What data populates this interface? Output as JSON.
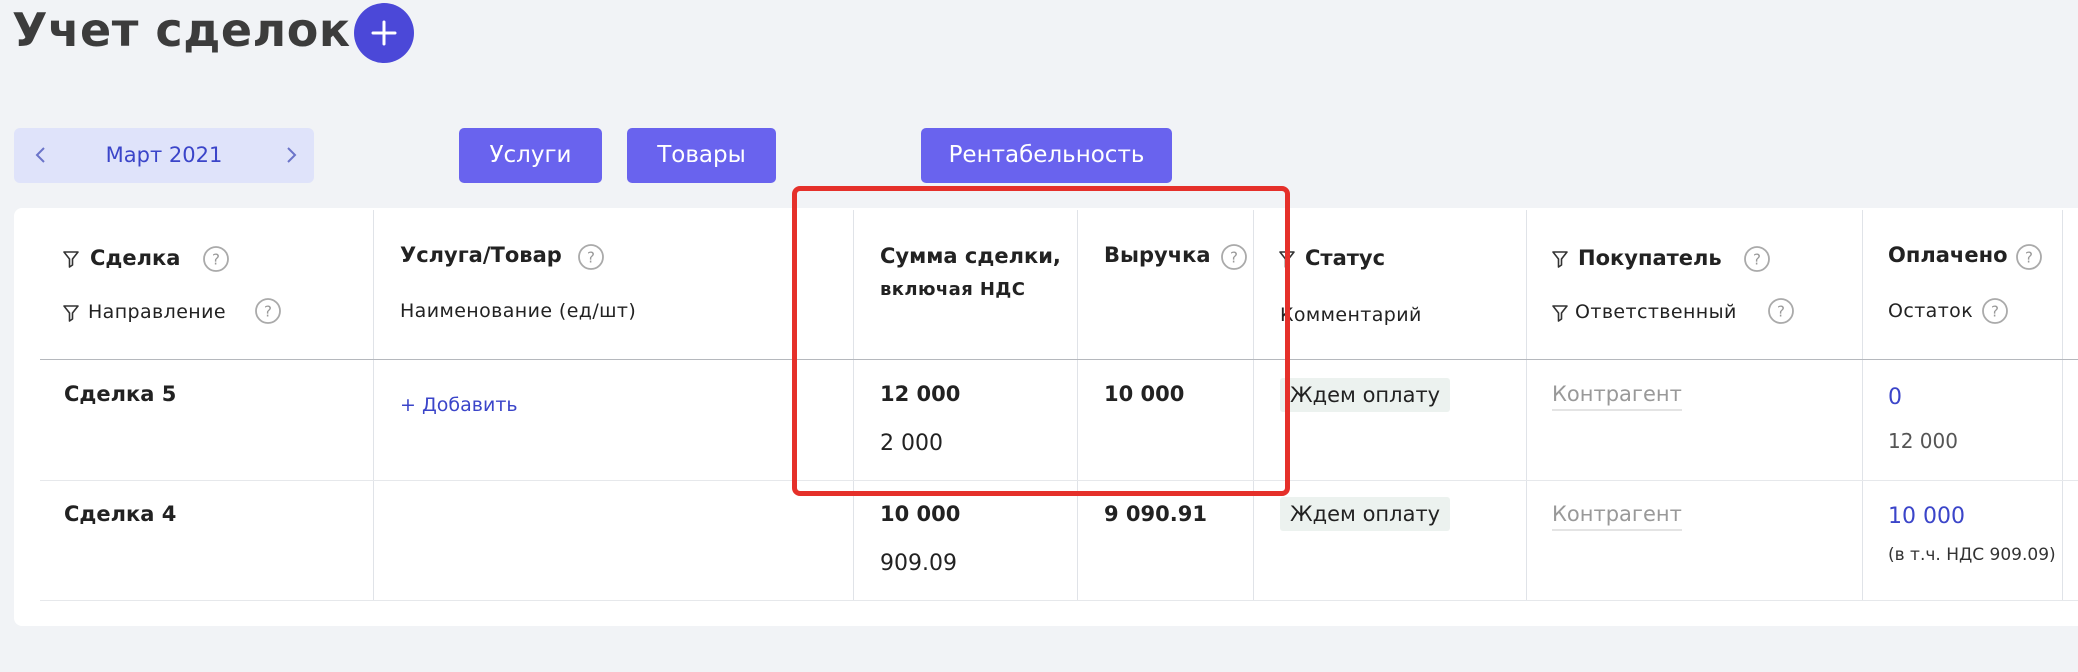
{
  "page": {
    "title": "Учет сделок"
  },
  "period": {
    "month_label": "Март 2021"
  },
  "tabs": {
    "services": "Услуги",
    "goods": "Товары",
    "profitability": "Рентабельность"
  },
  "table": {
    "columns": {
      "deal": "Сделка",
      "direction": "Направление",
      "service_goods": "Услуга/Товар",
      "item_name": "Наименование (ед/шт)",
      "amount_line1": "Сумма сделки,",
      "amount_line2": "включая НДС",
      "revenue": "Выручка",
      "status": "Статус",
      "comment": "Комментарий",
      "buyer": "Покупатель",
      "responsible": "Ответственный",
      "paid": "Оплачено",
      "balance": "Остаток"
    },
    "rows": [
      {
        "deal": "Сделка 5",
        "add_link": "+ Добавить",
        "amount": "12 000",
        "vat": "2 000",
        "revenue": "10 000",
        "status": "Ждем оплату",
        "buyer": "Контрагент",
        "paid": "0",
        "balance": "12 000"
      },
      {
        "deal": "Сделка 4",
        "amount": "10 000",
        "vat": "909.09",
        "revenue": "9 090.91",
        "status": "Ждем оплату",
        "buyer": "Контрагент",
        "paid": "10 000",
        "paid_note": "(в т.ч. НДС 909.09)"
      }
    ]
  },
  "colors": {
    "accent": "#4b48d8",
    "tab_bg": "#6963ee",
    "link": "#3b45c9",
    "highlight": "#e5302a"
  },
  "icons": {
    "add": "plus-icon",
    "prev": "chevron-left-icon",
    "next": "chevron-right-icon",
    "filter": "filter-icon",
    "help": "help-icon"
  }
}
